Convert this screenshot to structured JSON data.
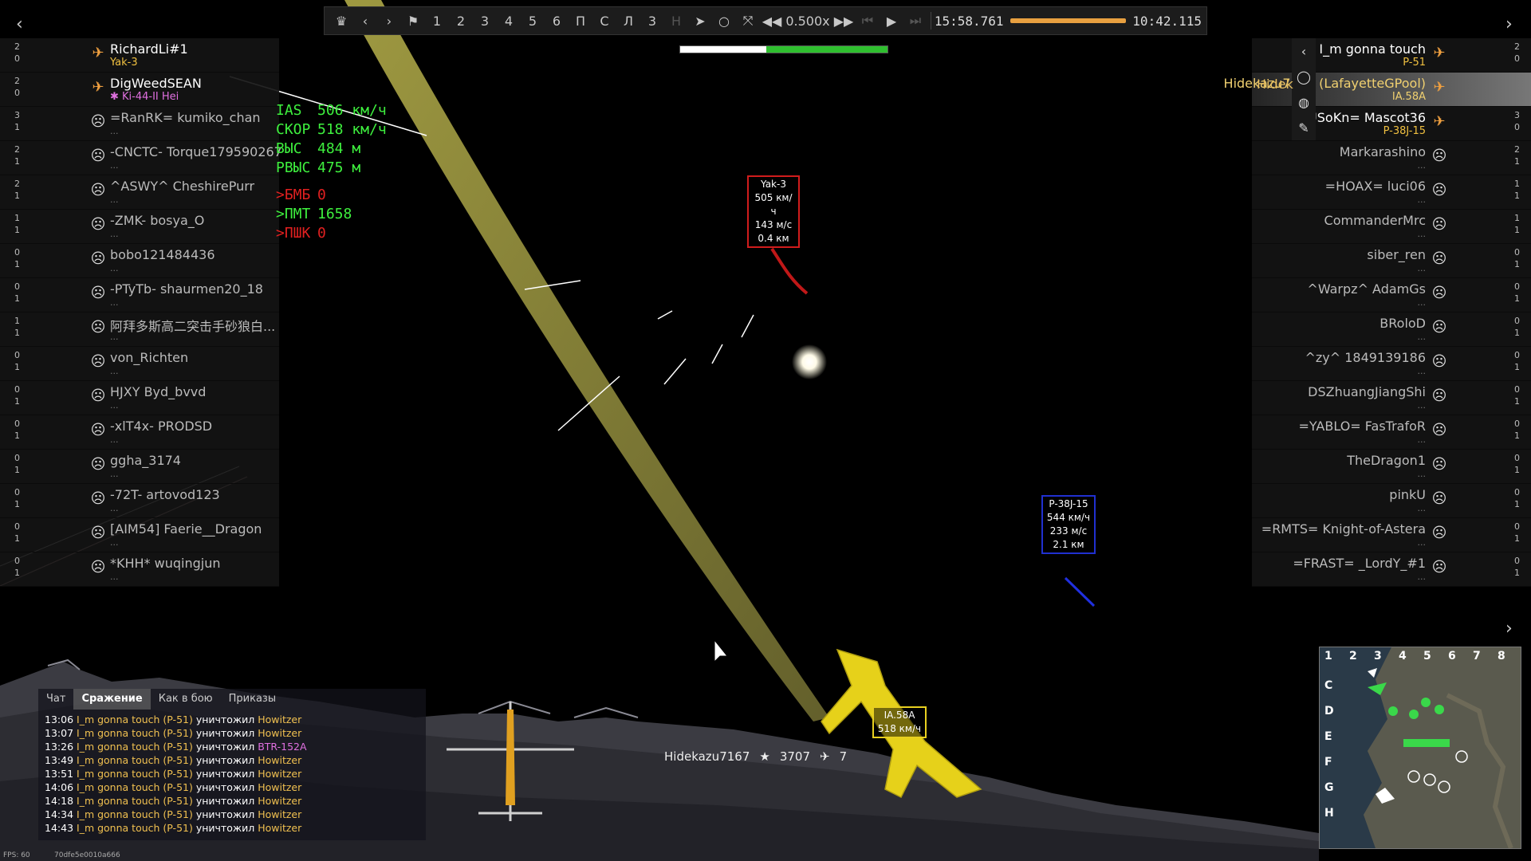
{
  "replay_bar": {
    "numbers": [
      "1",
      "2",
      "3",
      "4",
      "5",
      "6"
    ],
    "letters": [
      "П",
      "С",
      "Л",
      "3",
      "Н"
    ],
    "speed": "0.500x",
    "time_left": "15:58.761",
    "time_right": "10:42.115"
  },
  "left_players": [
    {
      "name": "RichardLi#1",
      "vehicle": "Yak-3",
      "stats": [
        "2",
        "0"
      ],
      "alive": true,
      "veh_color": "#f0c040"
    },
    {
      "name": "DigWeedSEAN",
      "vehicle": "✱ Ki-44-II Hei",
      "stats": [
        "2",
        "0"
      ],
      "alive": true,
      "veh_color": "#e070e0"
    },
    {
      "name": "=RanRK= kumiko_chan",
      "vehicle": "...",
      "stats": [
        "3",
        "1"
      ],
      "alive": false
    },
    {
      "name": "-CNCTC- Torque179590267",
      "vehicle": "...",
      "stats": [
        "2",
        "1"
      ],
      "alive": false
    },
    {
      "name": "^ASWY^ CheshirePurr",
      "vehicle": "...",
      "stats": [
        "2",
        "1"
      ],
      "alive": false
    },
    {
      "name": "-ZMK- bosya_O",
      "vehicle": "...",
      "stats": [
        "1",
        "1"
      ],
      "alive": false
    },
    {
      "name": "bobo121484436",
      "vehicle": "...",
      "stats": [
        "0",
        "1"
      ],
      "alive": false
    },
    {
      "name": "-PTyTb- shaurmen20_18",
      "vehicle": "...",
      "stats": [
        "0",
        "1"
      ],
      "alive": false
    },
    {
      "name": "阿拜多斯高二突击手砂狼白...",
      "vehicle": "...",
      "stats": [
        "1",
        "1"
      ],
      "alive": false
    },
    {
      "name": "von_Richten",
      "vehicle": "...",
      "stats": [
        "0",
        "1"
      ],
      "alive": false
    },
    {
      "name": "HJXY Byd_bvvd",
      "vehicle": "...",
      "stats": [
        "0",
        "1"
      ],
      "alive": false
    },
    {
      "name": "-xlT4x- PRODSD",
      "vehicle": "...",
      "stats": [
        "0",
        "1"
      ],
      "alive": false
    },
    {
      "name": "ggha_3174",
      "vehicle": "...",
      "stats": [
        "0",
        "1"
      ],
      "alive": false
    },
    {
      "name": "-72T- artovod123",
      "vehicle": "...",
      "stats": [
        "0",
        "1"
      ],
      "alive": false
    },
    {
      "name": "[AIM54] Faerie__Dragon",
      "vehicle": "...",
      "stats": [
        "0",
        "1"
      ],
      "alive": false
    },
    {
      "name": "*KHH* wuqingjun",
      "vehicle": "...",
      "stats": [
        "0",
        "1"
      ],
      "alive": false
    }
  ],
  "right_players": [
    {
      "name": "I_m gonna touch",
      "vehicle": "P-51",
      "stats": [
        "2",
        "0"
      ],
      "alive": true,
      "veh_color": "#f0c040"
    },
    {
      "name": "Hidekazu7167 (LafayetteGPool)",
      "vehicle": "IA.58A",
      "stats": [
        "",
        "",
        ""
      ],
      "alive": true,
      "veh_color": "#f0d070"
    },
    {
      "name": "=USoKn= Mascot36",
      "vehicle": "P-38J-15",
      "stats": [
        "3",
        "0"
      ],
      "alive": true,
      "veh_color": "#f0c040"
    },
    {
      "name": "Markarashino",
      "vehicle": "...",
      "stats": [
        "2",
        "1"
      ],
      "alive": false
    },
    {
      "name": "=HOAX= luci06",
      "vehicle": "...",
      "stats": [
        "1",
        "1"
      ],
      "alive": false
    },
    {
      "name": "CommanderMrc",
      "vehicle": "...",
      "stats": [
        "1",
        "1"
      ],
      "alive": false
    },
    {
      "name": "siber_ren",
      "vehicle": "...",
      "stats": [
        "0",
        "1"
      ],
      "alive": false
    },
    {
      "name": "^Warpz^ AdamGs",
      "vehicle": "...",
      "stats": [
        "0",
        "1"
      ],
      "alive": false
    },
    {
      "name": "BRoloD",
      "vehicle": "...",
      "stats": [
        "0",
        "1"
      ],
      "alive": false
    },
    {
      "name": "^zy^ 1849139186",
      "vehicle": "...",
      "stats": [
        "0",
        "1"
      ],
      "alive": false
    },
    {
      "name": "DSZhuangJiangShi",
      "vehicle": "...",
      "stats": [
        "0",
        "1"
      ],
      "alive": false
    },
    {
      "name": "=YABLO= FasTrafoR",
      "vehicle": "...",
      "stats": [
        "0",
        "1"
      ],
      "alive": false
    },
    {
      "name": "TheDragon1",
      "vehicle": "...",
      "stats": [
        "0",
        "1"
      ],
      "alive": false
    },
    {
      "name": "pinkU",
      "vehicle": "...",
      "stats": [
        "0",
        "1"
      ],
      "alive": false
    },
    {
      "name": "=RMTS= Knight-of-Astera",
      "vehicle": "...",
      "stats": [
        "0",
        "1"
      ],
      "alive": false
    },
    {
      "name": "=FRAST= _LordY_#1",
      "vehicle": "...",
      "stats": [
        "0",
        "1"
      ],
      "alive": false
    }
  ],
  "right_ext_label": "Hidek",
  "hud": {
    "ias_label": "IAS",
    "ias_value": "506 км/ч",
    "spd_label": "СКОР",
    "spd_value": "518 км/ч",
    "alt_label": "ВЫС",
    "alt_value": "484 м",
    "ralt_label": "РВЫС",
    "ralt_value": "475 м",
    "bmb_label": ">БМБ",
    "bmb_value": "0",
    "pmt_label": ">ПМТ",
    "pmt_value": "1658",
    "pshk_label": ">ПШК",
    "pshk_value": "0"
  },
  "targets": {
    "yak": [
      "Yak-3",
      "505 км/ч",
      "143 м/с",
      "0.4 км"
    ],
    "p38": [
      "P-38J-15",
      "544 км/ч",
      "233 м/с",
      "2.1 км"
    ],
    "ia": [
      "IA.58A",
      "518 км/ч"
    ]
  },
  "player_tag": {
    "name": "Hidekazu7167",
    "score": "3707",
    "kills": "7"
  },
  "chat": {
    "tabs": [
      "Чат",
      "Сражение",
      "Как в бою",
      "Приказы"
    ],
    "lines": [
      {
        "time": "13:06",
        "actor": "I_m gonna touch",
        "vehicle": "(P-51)",
        "verb": "уничтожил",
        "target": "Howitzer",
        "tcolor": "#f0c050"
      },
      {
        "time": "13:07",
        "actor": "I_m gonna touch",
        "vehicle": "(P-51)",
        "verb": "уничтожил",
        "target": "Howitzer",
        "tcolor": "#f0c050"
      },
      {
        "time": "13:26",
        "actor": "I_m gonna touch",
        "vehicle": "(P-51)",
        "verb": "уничтожил",
        "target": "BTR-152A",
        "tcolor": "#e070e0"
      },
      {
        "time": "13:49",
        "actor": "I_m gonna touch",
        "vehicle": "(P-51)",
        "verb": "уничтожил",
        "target": "Howitzer",
        "tcolor": "#f0c050"
      },
      {
        "time": "13:51",
        "actor": "I_m gonna touch",
        "vehicle": "(P-51)",
        "verb": "уничтожил",
        "target": "Howitzer",
        "tcolor": "#f0c050"
      },
      {
        "time": "14:06",
        "actor": "I_m gonna touch",
        "vehicle": "(P-51)",
        "verb": "уничтожил",
        "target": "Howitzer",
        "tcolor": "#f0c050"
      },
      {
        "time": "14:18",
        "actor": "I_m gonna touch",
        "vehicle": "(P-51)",
        "verb": "уничтожил",
        "target": "Howitzer",
        "tcolor": "#f0c050"
      },
      {
        "time": "14:34",
        "actor": "I_m gonna touch",
        "vehicle": "(P-51)",
        "verb": "уничтожил",
        "target": "Howitzer",
        "tcolor": "#f0c050"
      },
      {
        "time": "14:43",
        "actor": "I_m gonna touch",
        "vehicle": "(P-51)",
        "verb": "уничтожил",
        "target": "Howitzer",
        "tcolor": "#f0c050"
      }
    ]
  },
  "minimap": {
    "cols": [
      "1",
      "2",
      "3",
      "4",
      "5",
      "6",
      "7",
      "8"
    ],
    "rows": [
      "C",
      "D",
      "E",
      "F",
      "G",
      "H"
    ]
  },
  "footer": {
    "fps": "FPS: 60",
    "id": "70dfe5e0010a666"
  },
  "colors": {
    "hud_green": "#3ef03e",
    "hud_red": "#e02020",
    "ally": "#f0a040",
    "enemy_box": "#d01c1c",
    "p38_box": "#2030d0"
  }
}
